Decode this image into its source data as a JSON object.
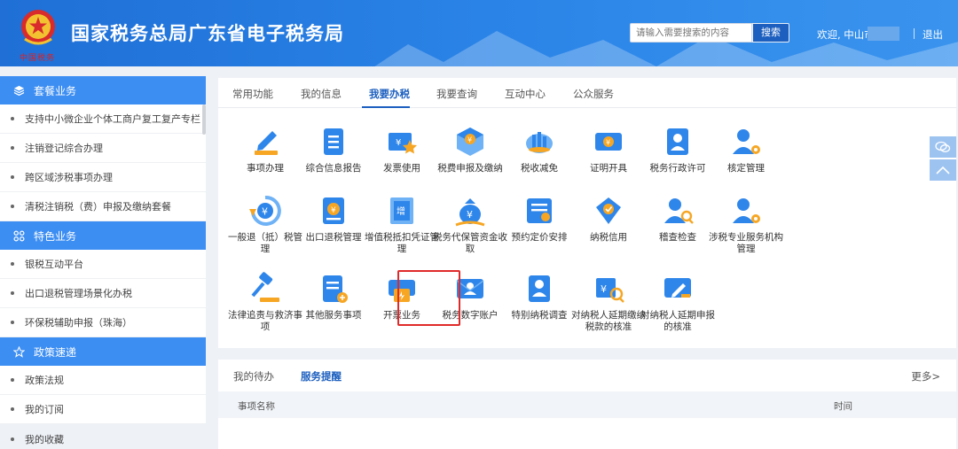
{
  "header": {
    "site_title": "国家税务总局广东省电子税务局",
    "emblem_caption": "中国税务",
    "search_placeholder": "请输入需要搜索的内容",
    "search_button": "搜索",
    "welcome": "欢迎, 中山市",
    "logout": "退出",
    "brand_color": "#2b85e8"
  },
  "sidebar": {
    "sections": [
      {
        "title": "套餐业务",
        "icon": "cube-icon",
        "items": [
          "支持中小微企业个体工商户复工复产专栏",
          "注销登记综合办理",
          "跨区域涉税事项办理",
          "清税注销税（费）申报及缴纳套餐"
        ]
      },
      {
        "title": "特色业务",
        "icon": "grid-icon",
        "items": [
          "银税互动平台",
          "出口退税管理场景化办税",
          "环保税辅助申报（珠海）"
        ]
      },
      {
        "title": "政策速递",
        "icon": "star-icon",
        "items": [
          "政策法规",
          "我的订阅",
          "我的收藏"
        ]
      }
    ]
  },
  "main": {
    "tabs": [
      "常用功能",
      "我的信息",
      "我要办税",
      "我要查询",
      "互动中心",
      "公众服务"
    ],
    "active_tab": "我要办税",
    "services": [
      {
        "label": "事项办理",
        "icon": "pen-icon"
      },
      {
        "label": "综合信息报告",
        "icon": "report-icon"
      },
      {
        "label": "发票使用",
        "icon": "invoice-star-icon"
      },
      {
        "label": "税费申报及缴纳",
        "icon": "tax-box-icon"
      },
      {
        "label": "税收减免",
        "icon": "coins-icon"
      },
      {
        "label": "证明开具",
        "icon": "certificate-icon"
      },
      {
        "label": "税务行政许可",
        "icon": "person-card-icon"
      },
      {
        "label": "核定管理",
        "icon": "person-gear-icon"
      },
      {
        "label": "一般退（抵）税管理",
        "icon": "refund-icon"
      },
      {
        "label": "出口退税管理",
        "icon": "export-refund-icon"
      },
      {
        "label": "增值税抵扣凭证管理",
        "icon": "vat-voucher-icon"
      },
      {
        "label": "税务代保管资金收取",
        "icon": "money-bag-icon"
      },
      {
        "label": "预约定价安排",
        "icon": "schedule-icon"
      },
      {
        "label": "纳税信用",
        "icon": "credit-shield-icon"
      },
      {
        "label": "稽查检查",
        "icon": "inspect-icon"
      },
      {
        "label": "涉税专业服务机构管理",
        "icon": "agency-icon"
      },
      {
        "label": "法律追责与救济事项",
        "icon": "gavel-icon"
      },
      {
        "label": "其他服务事项",
        "icon": "other-service-icon"
      },
      {
        "label": "开票业务",
        "icon": "printer-icon"
      },
      {
        "label": "税务数字账户",
        "icon": "digital-account-icon"
      },
      {
        "label": "特别纳税调查",
        "icon": "investigation-icon"
      },
      {
        "label": "对纳税人延期缴纳税款的核准",
        "icon": "defer-payment-icon"
      },
      {
        "label": "对纳税人延期申报的核准",
        "icon": "defer-filing-icon"
      }
    ]
  },
  "todo": {
    "tabs": [
      "我的待办",
      "服务提醒"
    ],
    "active_tab": "服务提醒",
    "more": "更多>",
    "columns": [
      "事项名称",
      "时间"
    ]
  }
}
